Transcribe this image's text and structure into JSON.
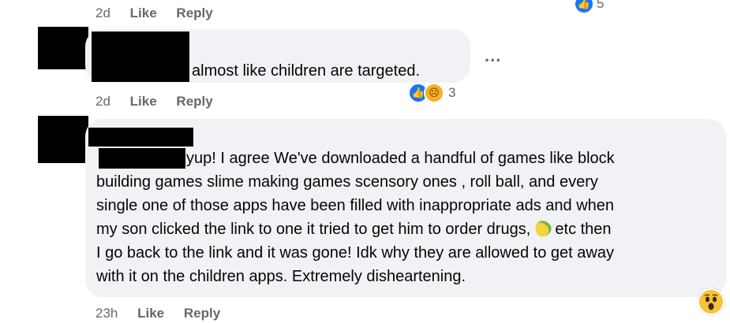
{
  "comment1": {
    "time": "2d",
    "like_label": "Like",
    "reply_label": "Reply",
    "reaction_count": "5"
  },
  "comment2": {
    "text": "almost like children are targeted.",
    "time": "2d",
    "like_label": "Like",
    "reply_label": "Reply",
    "reaction_count": "3",
    "more_label": "..."
  },
  "comment3": {
    "text_line1": "yup! I agree We've downloaded a handful of games like block",
    "text_line2": "building games slime making games scensory ones , roll ball, and every",
    "text_line3": "single one of those apps have been filled with inappropriate ads and when",
    "text_line4_a": "my son clicked the link to one it tried to get him to order drugs,",
    "text_line4_b": "etc then",
    "text_line5": "I go back to the link and it was gone! Idk why they are allowed to get away",
    "text_line6": "with it on the children apps. Extremely disheartening.",
    "time": "23h",
    "like_label": "Like",
    "reply_label": "Reply"
  },
  "icons": {
    "like": "like-reaction-icon",
    "sad": "sad-reaction-icon",
    "wow": "wow-reaction-icon",
    "corn": "corn-emoji"
  },
  "colors": {
    "bubble": "#f0f2f5",
    "meta": "#65676b",
    "like_blue": "#1877f2"
  }
}
